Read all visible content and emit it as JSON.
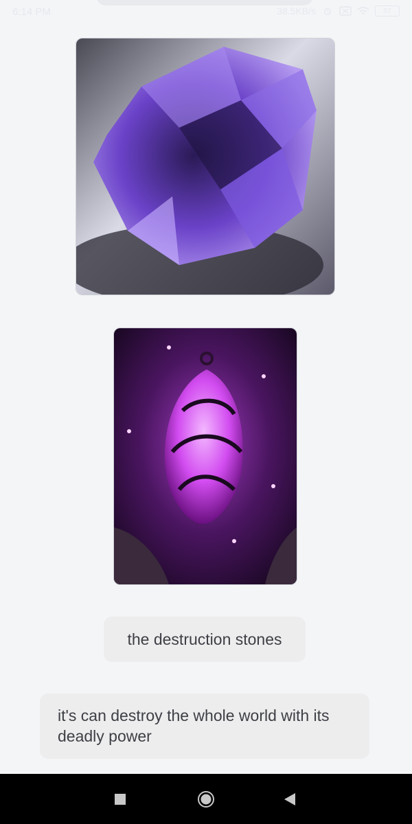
{
  "status_bar": {
    "time": "6:14 PM",
    "network_speed": "38.5KB/s",
    "battery": "57",
    "icons": [
      "alarm-icon",
      "sim-icon",
      "wifi-icon",
      "battery-icon"
    ]
  },
  "chat": {
    "images": [
      {
        "name": "purple-crystal-photo",
        "caption": ""
      },
      {
        "name": "pink-crystal-pendant-art",
        "caption": ""
      }
    ],
    "messages": [
      {
        "text": "the destruction stones"
      },
      {
        "text": "it's can destroy the whole world with its deadly power"
      }
    ]
  },
  "nav_bar": {
    "buttons": [
      "square-nav-icon",
      "circle-home-icon",
      "triangle-back-icon"
    ]
  },
  "colors": {
    "background": "#f4f5f7",
    "bubble": "#ededee",
    "text": "#3d3f44",
    "nav": "#000000"
  }
}
